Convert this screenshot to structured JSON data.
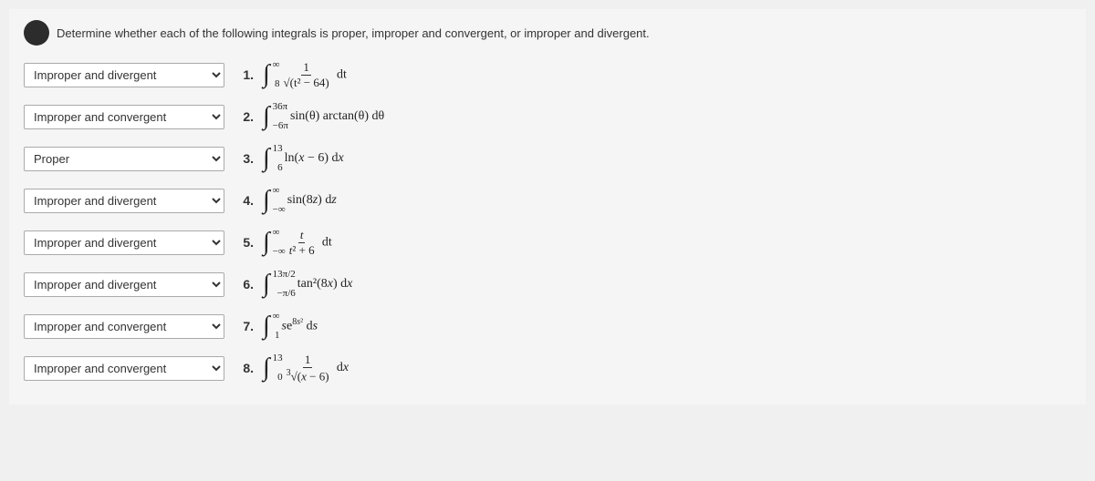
{
  "instructions": "Determine whether each of the following integrals is proper, improper and convergent, or improper and divergent.",
  "options": [
    "Proper",
    "Improper and convergent",
    "Improper and divergent"
  ],
  "problems": [
    {
      "id": 1,
      "selected": "Improper and divergent",
      "latex_desc": "integral from 8 to infinity of 1/sqrt(t^2-64) dt"
    },
    {
      "id": 2,
      "selected": "Improper and convergent",
      "latex_desc": "integral from -6pi to 36pi of sin(theta)*arctan(theta) dtheta"
    },
    {
      "id": 3,
      "selected": "Proper",
      "latex_desc": "integral from 6 to 13 of ln(x-6) dx"
    },
    {
      "id": 4,
      "selected": "Improper and divergent",
      "latex_desc": "integral from -infinity to infinity of sin(8z) dz"
    },
    {
      "id": 5,
      "selected": "Improper and divergent",
      "latex_desc": "integral from -infinity to infinity of t/(t^2+6) dt"
    },
    {
      "id": 6,
      "selected": "Improper and divergent",
      "latex_desc": "integral from -pi/6 to 13pi/2 of tan^2(8x) dx"
    },
    {
      "id": 7,
      "selected": "Improper and convergent",
      "latex_desc": "integral from 1 to infinity of s*e^(8s^2) ds"
    },
    {
      "id": 8,
      "selected": "Improper and convergent",
      "latex_desc": "integral from 0 to 13 of 1/(x-6)^(1/3) dx"
    }
  ]
}
